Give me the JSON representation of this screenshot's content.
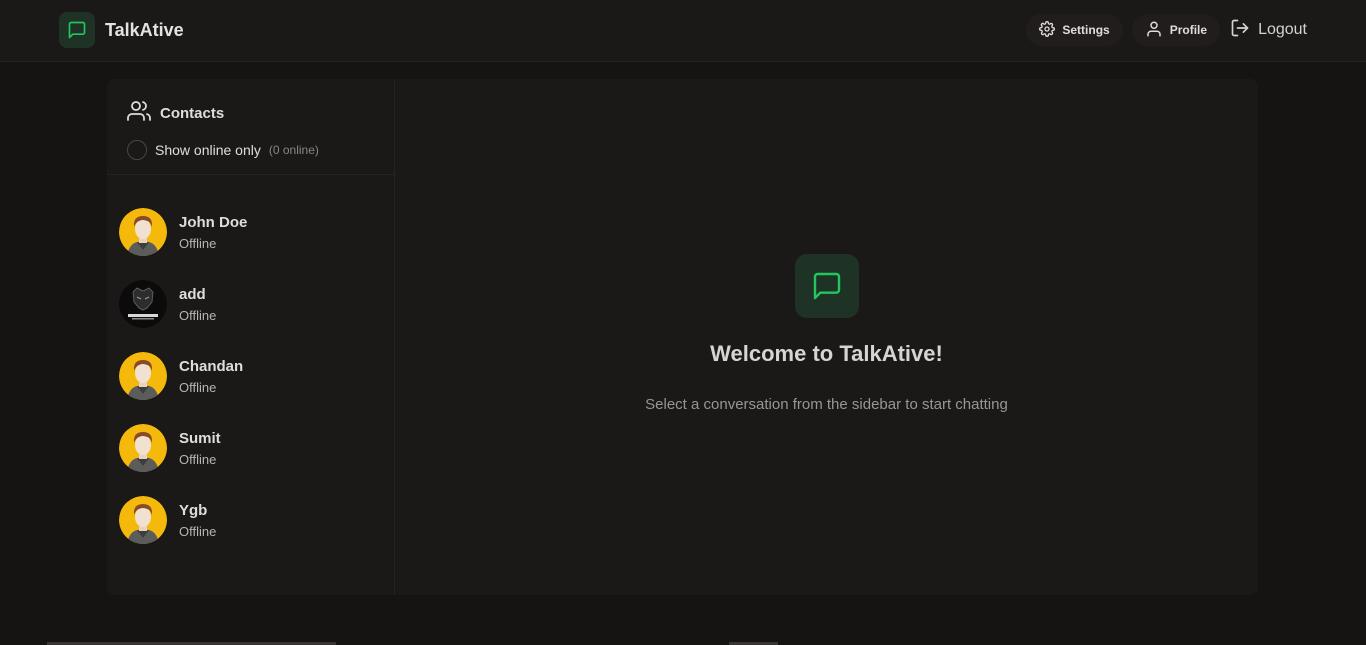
{
  "header": {
    "app_name": "TalkAtive",
    "settings_label": "Settings",
    "profile_label": "Profile",
    "logout_label": "Logout"
  },
  "sidebar": {
    "title": "Contacts",
    "filter_label": "Show online only",
    "online_count": "(0 online)",
    "contacts": [
      {
        "name": "John Doe",
        "status": "Offline",
        "avatar": "default-avatar"
      },
      {
        "name": "add",
        "status": "Offline",
        "avatar": "black-panther-avatar"
      },
      {
        "name": "Chandan",
        "status": "Offline",
        "avatar": "default-avatar"
      },
      {
        "name": "Sumit",
        "status": "Offline",
        "avatar": "default-avatar"
      },
      {
        "name": "Ygb",
        "status": "Offline",
        "avatar": "default-avatar"
      }
    ]
  },
  "main": {
    "welcome_title": "Welcome to TalkAtive!",
    "welcome_subtitle": "Select a conversation from the sidebar to start chatting"
  },
  "colors": {
    "accent": "#22c55e",
    "background": "#161313",
    "panel": "#1b1818",
    "avatar_yellow": "#f5b90c"
  }
}
